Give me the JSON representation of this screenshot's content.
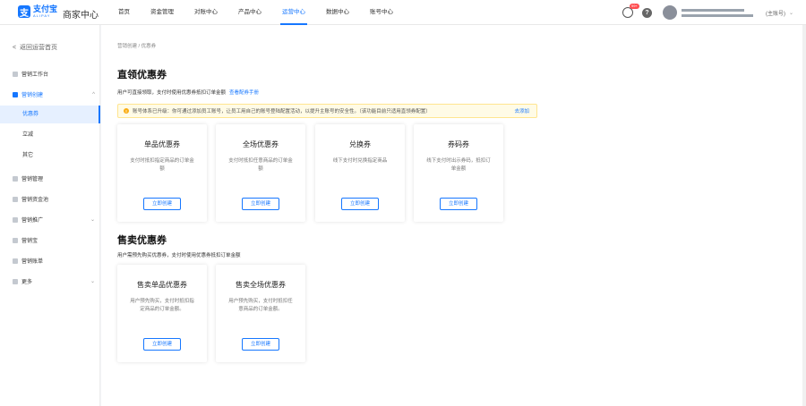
{
  "header": {
    "logo_cn": "支付宝",
    "logo_en": "ALIPAY",
    "brand": "商家中心",
    "nav": [
      "首页",
      "资金管理",
      "对账中心",
      "产品中心",
      "运营中心",
      "数据中心",
      "账号中心"
    ],
    "active_nav": "运营中心",
    "badge": "99+",
    "help_glyph": "?",
    "account_role": "(主账号)"
  },
  "sidebar": {
    "back": "返回运营首页",
    "items": [
      {
        "label": "营销工作台"
      },
      {
        "label": "营销创建"
      },
      {
        "label": "营销管理"
      },
      {
        "label": "营销资金池"
      },
      {
        "label": "营销推广"
      },
      {
        "label": "营销宝"
      },
      {
        "label": "营销账单"
      },
      {
        "label": "更多"
      }
    ],
    "sub_items": [
      "优惠券",
      "立减",
      "其它"
    ]
  },
  "main": {
    "breadcrumb": "营销创建 / 优惠券",
    "section1": {
      "title": "直领优惠券",
      "desc": "用户可直接领取，支付时使用优惠券抵扣订单金额",
      "link": "查看配券手册"
    },
    "notice": {
      "text": "账号体系已升级：你可通过添加员工账号，让员工用自己的账号登陆配置活动，以提升主账号的安全性。（该功能目前只适用直领券配置）",
      "action": "去添加"
    },
    "cards1": [
      {
        "title": "单品优惠券",
        "desc": "支付时抵扣指定商品的订单金额",
        "button": "立即创建"
      },
      {
        "title": "全场优惠券",
        "desc": "支付时抵扣任意商品的订单金额",
        "button": "立即创建"
      },
      {
        "title": "兑换券",
        "desc": "线下支付时兑换指定商品",
        "button": "立即创建"
      },
      {
        "title": "券码券",
        "desc": "线下支付时出示券码，抵扣订单金额",
        "button": "立即创建"
      }
    ],
    "section2": {
      "title": "售卖优惠券",
      "desc": "用户需预先购买优惠券，支付时使用优惠券抵扣订单金额"
    },
    "cards2": [
      {
        "title": "售卖单品优惠券",
        "desc": "用户预先购买，支付时抵扣指定商品的订单金额。",
        "button": "立即创建"
      },
      {
        "title": "售卖全场优惠券",
        "desc": "用户预先购买，支付时抵扣任意商品的订单金额。",
        "button": "立即创建"
      }
    ]
  },
  "colors": {
    "accent": "#1677ff",
    "warning_bg": "#fffbe6",
    "badge": "#ff4d4f"
  }
}
